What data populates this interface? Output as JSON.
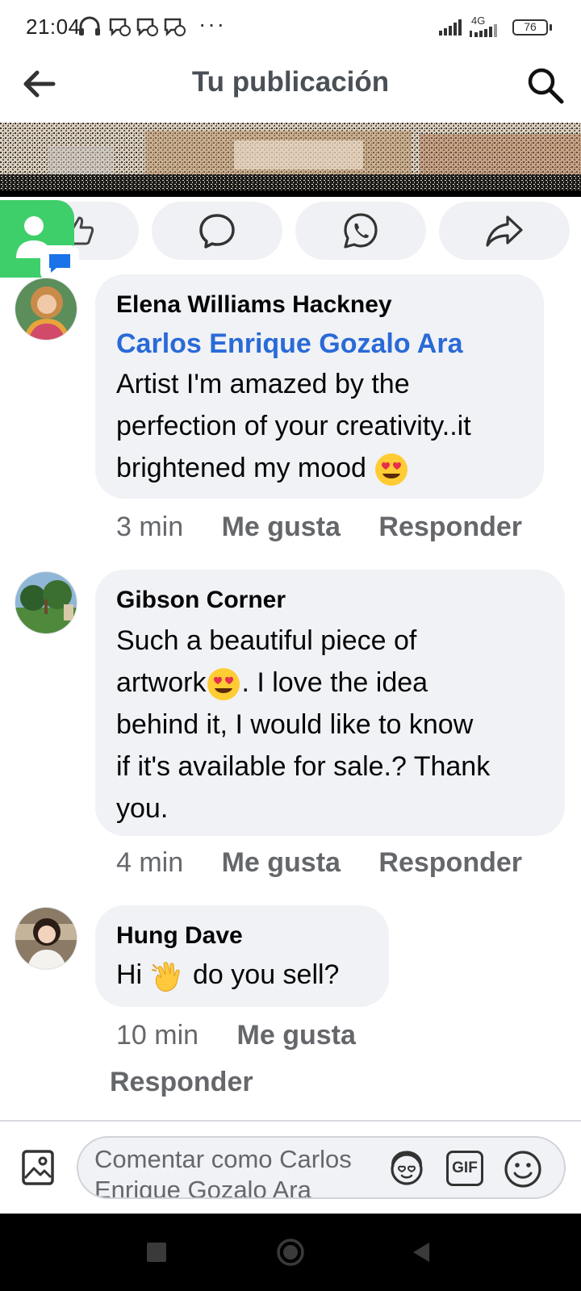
{
  "status_bar": {
    "time": "21:04",
    "network": "4G",
    "battery": "76",
    "overflow": "···"
  },
  "header": {
    "title": "Tu publicación",
    "back_icon": "arrow-left-icon",
    "search_icon": "search-icon"
  },
  "post_actions": [
    {
      "name": "like",
      "icon": "thumb-up-icon"
    },
    {
      "name": "comment",
      "icon": "comment-bubble-icon"
    },
    {
      "name": "whatsapp",
      "icon": "whatsapp-icon"
    },
    {
      "name": "share",
      "icon": "share-arrow-icon"
    }
  ],
  "comments": [
    {
      "author": "Elena Williams Hackney",
      "mention": "Carlos Enrique Gozalo Ara",
      "lines": [
        "Artist I'm amazed by the",
        "perfection of your creativity..it",
        "brightened my mood"
      ],
      "time": "3 min",
      "like_label": "Me gusta",
      "reply_label": "Responder"
    },
    {
      "author": "Gibson Corner",
      "lines": [
        "Such a beautiful piece of",
        "artwork",
        ". I love the idea",
        "behind it, I would like to know",
        "if it's available for sale.? Thank",
        "you."
      ],
      "time": "4 min",
      "like_label": "Me gusta",
      "reply_label": "Responder"
    },
    {
      "author": "Hung Dave",
      "text_before": "Hi",
      "text_after": "do you sell?",
      "time": "10 min",
      "like_label": "Me gusta",
      "reply_label": "Responder"
    }
  ],
  "composer": {
    "placeholder": "Comentar como Carlos Enrique Gozalo Ara",
    "icons": [
      "image-icon",
      "avatar-sticker-icon",
      "gif-icon",
      "emoji-icon"
    ],
    "gif_label": "GIF"
  },
  "colors": {
    "accent": "#2a6ad8",
    "bubble": "#f0f2f5",
    "meta": "#65676b",
    "floating_app": "#3ecf6a"
  }
}
